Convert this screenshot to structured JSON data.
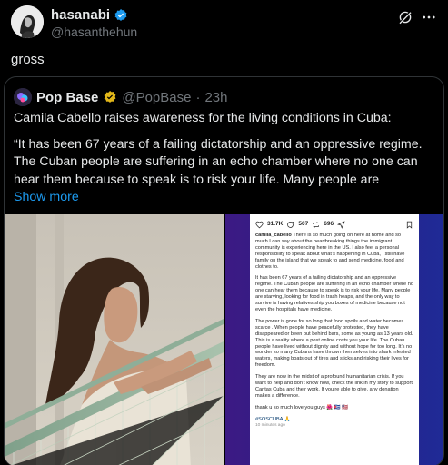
{
  "tweet": {
    "author_name": "hasanabi",
    "author_handle": "@hasanthehun",
    "text": "gross"
  },
  "quoted": {
    "author_name": "Pop Base",
    "author_handle": "@PopBase",
    "separator": "·",
    "time": "23h",
    "headline": "Camila Cabello raises awareness for the living conditions in Cuba:",
    "quote_text": "“It has been 67 years of a failing dictatorship and an oppressive regime. The Cuban people are suffering in an echo chamber where no one can hear them because to speak is to risk your life. Many people are",
    "show_more": "Show more"
  },
  "instagram": {
    "likes": "31.7K",
    "comments": "507",
    "shares": "696",
    "username": "camila_cabello",
    "para1": "There is so much going on here at home and so much I can say about  the heartbreaking things the immigrant community is experiencing here in the US. I also feel a personal responsibility to speak about what’s happening in Cuba, I still  have family on the island that we speak to and send medicine, food and clothes to.",
    "para2": "It has been 67 years of a failing dictatorship and an oppressive regime. The Cuban people are suffering in an echo chamber where no one can hear them because to speak is to risk your life. Many people are starving, looking for food in trash heaps, and the only way to survive is having relatives ship you boxes of medicine because not even the hospitals have medicine.",
    "para3": "The power is gone for so long that food spoils and water becomes scarce . When people have peacefully protested, they have disappeared or been put behind bars, some as young as 13 years old. This is a reality where a post online costs you your life. The Cuban people have lived without dignity and without hope for too long. It’s no wonder so many Cubans have thrown themselves into shark infested waters, making boats out of tires and sticks and risking their lives for freedom.",
    "para4": "They are now in the midst of a profound humanitarian crisis. If you want to help and don’t know how, check the link in my story to support Caritas Cuba and their work. If you’re able to give, any donation makes a difference.",
    "signoff": "thank u so much love you guys 🌺 🇨🇺 🇺🇸",
    "hashtag": "#SOSCUBA 🙏",
    "timestamp": "10 minutes ago"
  },
  "icons": {
    "verified": "verified-badge-icon",
    "grok": "grok-icon",
    "more": "more-options-icon",
    "heart": "heart-icon",
    "comment": "comment-icon",
    "repost": "repost-icon",
    "share": "share-icon",
    "bookmark": "bookmark-icon"
  },
  "colors": {
    "background": "#000000",
    "text": "#e7e9ea",
    "muted": "#71767b",
    "accent": "#1d9bf0",
    "border": "#2f3336"
  }
}
